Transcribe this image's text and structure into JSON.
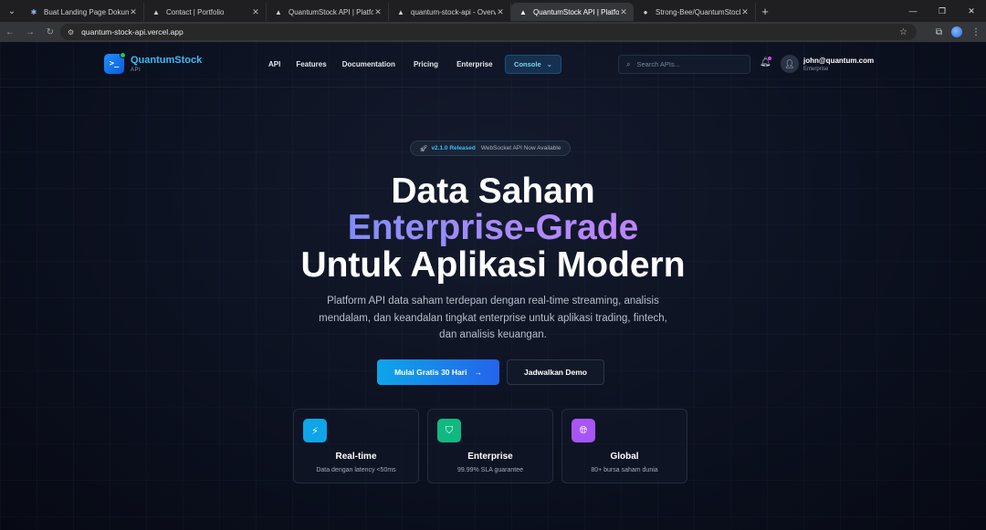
{
  "browser": {
    "tabs": [
      {
        "title": "Buat Landing Page Dokumentasi",
        "icon": "claude-icon",
        "active": false
      },
      {
        "title": "Contact | Portfolio",
        "icon": "vercel-icon",
        "active": false
      },
      {
        "title": "QuantumStock API | Platform Data",
        "icon": "vercel-icon",
        "active": false
      },
      {
        "title": "quantum-stock-api - Overview",
        "icon": "vercel-icon",
        "active": false
      },
      {
        "title": "QuantumStock API | Platform Data",
        "icon": "vercel-icon",
        "active": true
      },
      {
        "title": "Strong-Bee/QuantumStock-API",
        "icon": "github-icon",
        "active": false
      }
    ],
    "url": "quantum-stock-api.vercel.app"
  },
  "nav": {
    "brand": "QuantumStock",
    "brand_sub": "API",
    "menu": [
      "API",
      "Features",
      "Documentation",
      "Pricing",
      "Enterprise"
    ],
    "console_label": "Console",
    "search_placeholder": "Search APIs...",
    "user_name": "john@quantum.com",
    "user_plan": "Enterprise"
  },
  "hero": {
    "badge_version": "v2.1.0 Released",
    "badge_text": "WebSocket API Now Available",
    "line1": "Data Saham",
    "line2": "Enterprise-Grade",
    "line3": "Untuk Aplikasi Modern",
    "subtitle": "Platform API data saham terdepan dengan real-time streaming, analisis mendalam, dan keandalan tingkat enterprise untuk aplikasi trading, fintech, dan analisis keuangan.",
    "cta_primary": "Mulai Gratis 30 Hari",
    "cta_secondary": "Jadwalkan Demo"
  },
  "features": [
    {
      "title": "Real-time",
      "desc": "Data dengan latency <50ms",
      "icon": "lightning-icon",
      "color": "#0ea5e9"
    },
    {
      "title": "Enterprise",
      "desc": "99.99% SLA guarantee",
      "icon": "shield-icon",
      "color": "#10b981"
    },
    {
      "title": "Global",
      "desc": "80+ bursa saham dunia",
      "icon": "globe-icon",
      "color": "#a855f7"
    }
  ]
}
